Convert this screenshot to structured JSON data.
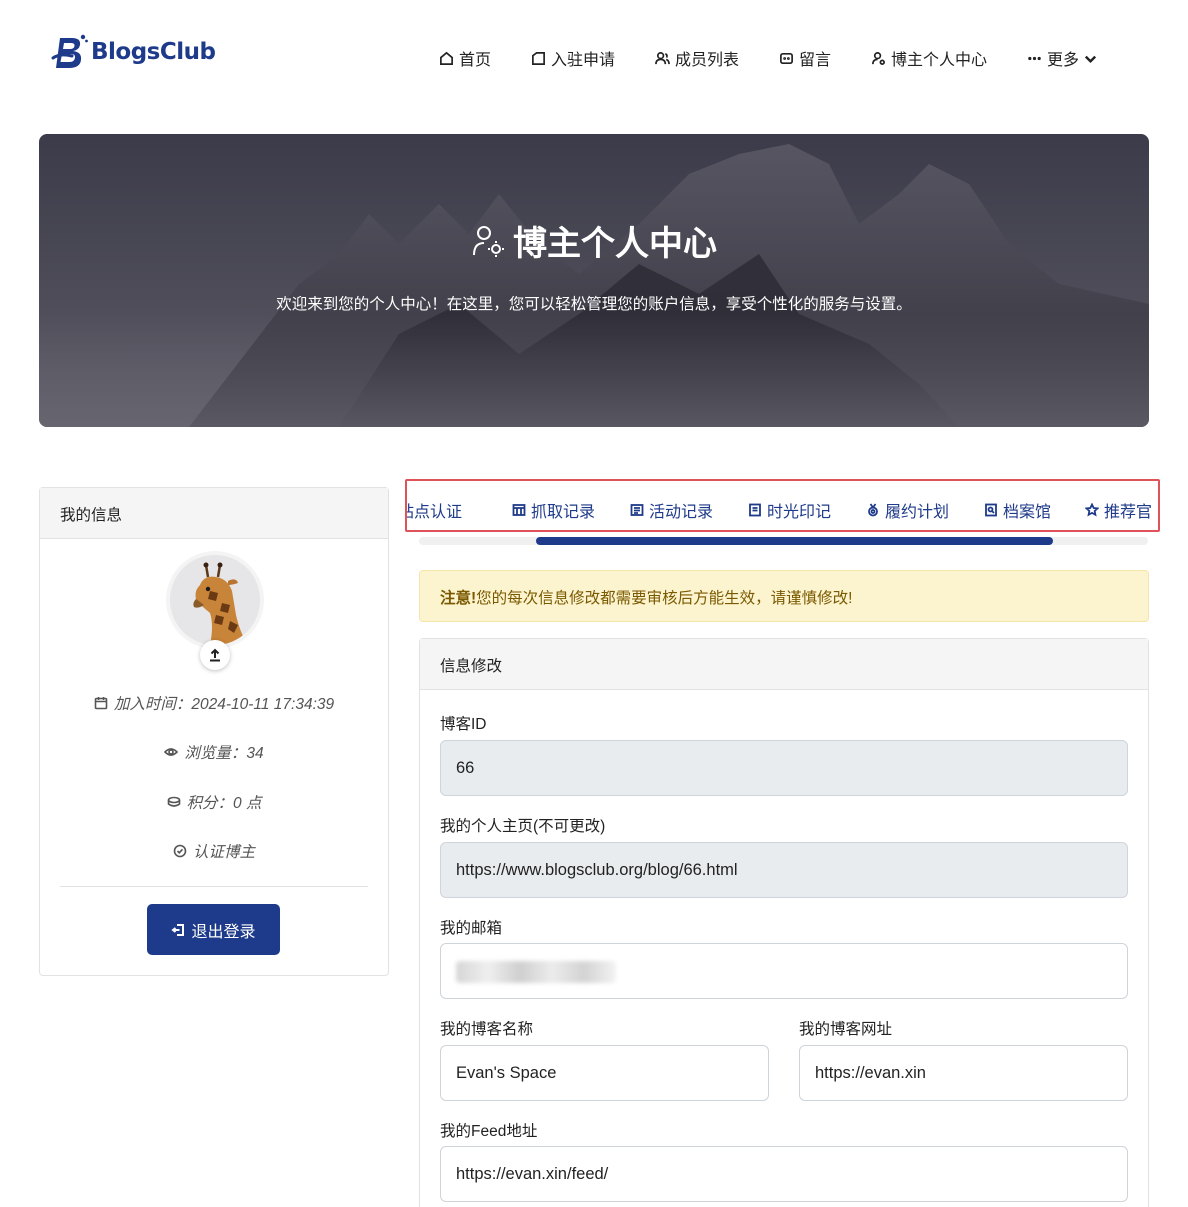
{
  "brand": {
    "name": "BlogsClub",
    "color": "#1e3a8a"
  },
  "nav": [
    {
      "label": "首页",
      "icon": "home-icon"
    },
    {
      "label": "入驻申请",
      "icon": "tag-icon"
    },
    {
      "label": "成员列表",
      "icon": "users-icon"
    },
    {
      "label": "留言",
      "icon": "message-icon"
    },
    {
      "label": "博主个人中心",
      "icon": "user-gear-icon"
    },
    {
      "label": "更多",
      "icon": "dots-icon"
    }
  ],
  "hero": {
    "title": "博主个人中心",
    "subtitle": "欢迎来到您的个人中心！在这里，您可以轻松管理您的账户信息，享受个性化的服务与设置。"
  },
  "profile": {
    "header": "我的信息",
    "join_time": "加入时间：2024-10-11 17:34:39",
    "views": "浏览量：34",
    "points": "积分：0 点",
    "verified": "认证博主",
    "logout": "退出登录"
  },
  "tabs": [
    {
      "label": "站点认证",
      "icon": ""
    },
    {
      "label": "抓取记录",
      "icon": "table-icon"
    },
    {
      "label": "活动记录",
      "icon": "list-icon"
    },
    {
      "label": "时光印记",
      "icon": "document-icon"
    },
    {
      "label": "履约计划",
      "icon": "medal-icon"
    },
    {
      "label": "档案馆",
      "icon": "archive-icon"
    },
    {
      "label": "推荐官",
      "icon": "star-icon"
    }
  ],
  "tabs_scroll": {
    "visible_start": 0.16,
    "visible_fraction": 0.71
  },
  "notice": {
    "strong": "注意!",
    "text": "您的每次信息修改都需要审核后方能生效，请谨慎修改!"
  },
  "form": {
    "header": "信息修改",
    "blog_id_label": "博客ID",
    "blog_id_value": "66",
    "homepage_label": "我的个人主页(不可更改)",
    "homepage_value": "https://www.blogsclub.org/blog/66.html",
    "email_label": "我的邮箱",
    "email_value": "",
    "blog_name_label": "我的博客名称",
    "blog_name_value": "Evan's Space",
    "blog_url_label": "我的博客网址",
    "blog_url_value": "https://evan.xin",
    "feed_label": "我的Feed地址",
    "feed_value": "https://evan.xin/feed/"
  }
}
